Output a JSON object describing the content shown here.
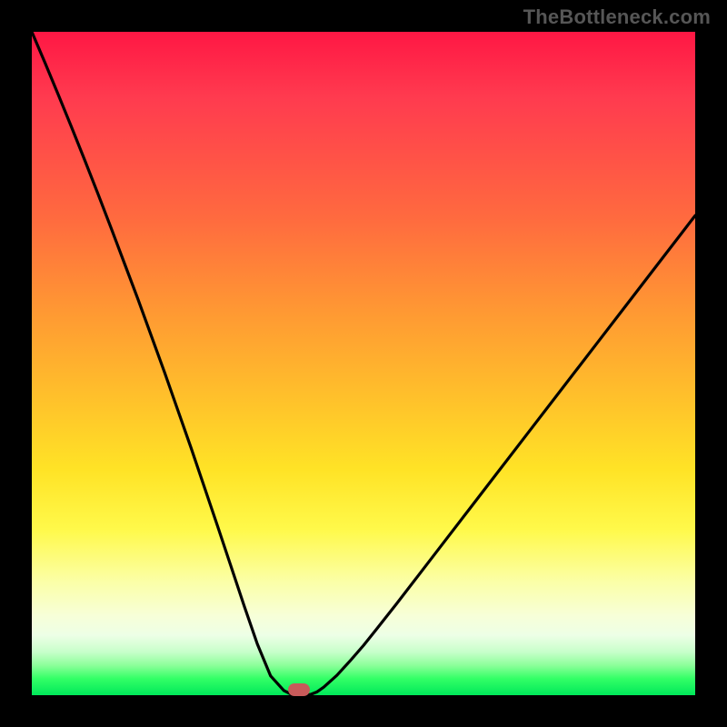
{
  "attribution": "TheBottleneck.com",
  "colors": {
    "frame": "#000000",
    "gradient_top": "#ff1744",
    "gradient_mid": "#ffe326",
    "gradient_bottom": "#00e85a",
    "curve": "#000000",
    "marker": "#c85a5a",
    "attribution_text": "#565656"
  },
  "chart_data": {
    "type": "line",
    "title": "",
    "xlabel": "",
    "ylabel": "",
    "xlim": [
      0,
      100
    ],
    "ylim": [
      0,
      100
    ],
    "x": [
      0,
      2,
      4,
      6,
      8,
      10,
      12,
      14,
      16,
      18,
      20,
      22,
      24,
      26,
      28,
      30,
      32,
      34,
      36,
      38,
      39,
      39.5,
      40,
      40.5,
      41,
      42,
      43,
      44,
      46,
      48,
      50,
      52,
      55,
      58,
      62,
      66,
      70,
      75,
      80,
      85,
      90,
      95,
      100
    ],
    "values": [
      100,
      95.3,
      90.5,
      85.6,
      80.6,
      75.5,
      70.3,
      65.0,
      59.7,
      54.2,
      48.7,
      43.0,
      37.3,
      31.4,
      25.5,
      19.5,
      13.5,
      7.7,
      2.9,
      0.7,
      0.2,
      0.1,
      0.0,
      0.0,
      0.0,
      0.1,
      0.5,
      1.2,
      3.0,
      5.2,
      7.5,
      10.0,
      13.8,
      17.7,
      22.9,
      28.1,
      33.3,
      39.8,
      46.3,
      52.8,
      59.3,
      65.8,
      72.3
    ],
    "annotations": [
      {
        "type": "marker",
        "x": 40.3,
        "y": 0.8,
        "shape": "pill",
        "color": "#c85a5a"
      }
    ],
    "notes": "V-shaped bottleneck curve over a vertical spectrum gradient. Minimum (bottleneck ~0) around x≈40. No axis ticks or labels are visible; values are proportional estimates on a 0–100 scale read from the image geometry."
  }
}
